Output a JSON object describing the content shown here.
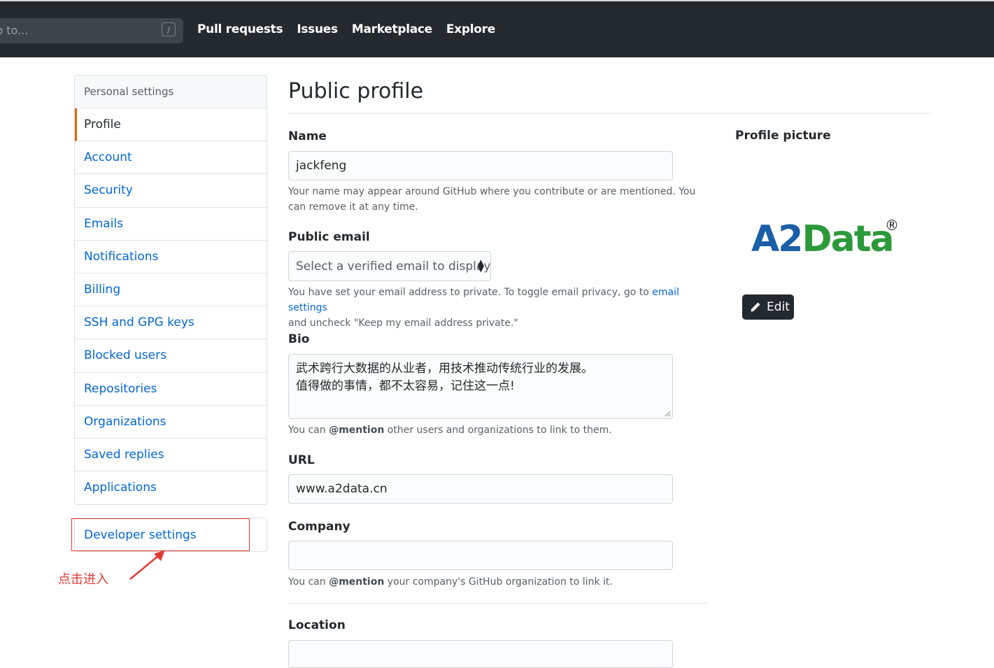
{
  "header": {
    "search_placeholder": "p to...",
    "search_shortcut": "/",
    "nav": [
      "Pull requests",
      "Issues",
      "Marketplace",
      "Explore"
    ]
  },
  "sidebar": {
    "heading": "Personal settings",
    "items": [
      {
        "label": "Profile",
        "active": true
      },
      {
        "label": "Account"
      },
      {
        "label": "Security"
      },
      {
        "label": "Emails"
      },
      {
        "label": "Notifications"
      },
      {
        "label": "Billing"
      },
      {
        "label": "SSH and GPG keys"
      },
      {
        "label": "Blocked users"
      },
      {
        "label": "Repositories"
      },
      {
        "label": "Organizations"
      },
      {
        "label": "Saved replies"
      },
      {
        "label": "Applications"
      }
    ],
    "developer_settings": "Developer settings"
  },
  "annotation": {
    "text": "点击进入",
    "color": "#e53935"
  },
  "main": {
    "title": "Public profile",
    "name_label": "Name",
    "name_value": "jackfeng",
    "name_note": "Your name may appear around GitHub where you contribute or are mentioned. You can remove it at any time.",
    "email_label": "Public email",
    "email_select": "Select a verified email to display",
    "email_note_prefix": "You have set your email address to private. To toggle email privacy, go to ",
    "email_note_link": "email settings",
    "email_note_suffix": "and uncheck \"Keep my email address private.\"",
    "bio_label": "Bio",
    "bio_line1": "武术跨行大数据的从业者，用技术推动传统行业的发展。",
    "bio_line2": "值得做的事情，都不太容易，记住这一点!",
    "bio_note_prefix": "You can ",
    "bio_note_mention": "@mention",
    "bio_note_suffix": " other users and organizations to link to them.",
    "url_label": "URL",
    "url_value": "www.a2data.cn",
    "company_label": "Company",
    "company_value": "",
    "company_note_prefix": "You can ",
    "company_note_mention": "@mention",
    "company_note_suffix": " your company's GitHub organization to link it.",
    "location_label": "Location",
    "location_value": ""
  },
  "profile_picture": {
    "label": "Profile picture",
    "logo_text_a2": "A2",
    "logo_text_data": "Data",
    "logo_reg": "®",
    "edit_label": "Edit"
  },
  "colors": {
    "header_bg": "#24292e",
    "link": "#0366d6",
    "active_border": "#e36209",
    "logo_blue": "#1a5fa8",
    "logo_green": "#2c9a3a"
  }
}
